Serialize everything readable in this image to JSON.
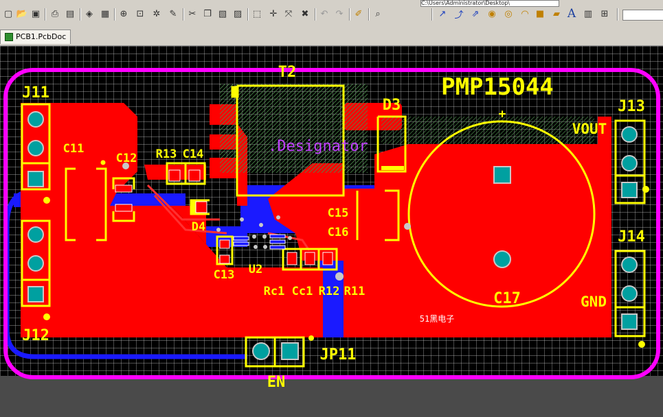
{
  "window": {
    "path": "C:\\Users\\Administrator\\Desktop\\"
  },
  "tab": {
    "label": "PCB1.PcbDoc"
  },
  "board": {
    "title": "PMP15044",
    "label_vout": "VOUT",
    "label_gnd": "GND",
    "label_en": "EN",
    "watermark": "51黑电子",
    "designator_text": ".Designator",
    "plus": "+",
    "components": {
      "T2": "T2",
      "D3": "D3",
      "J11": "J11",
      "J12": "J12",
      "J13": "J13",
      "J14": "J14",
      "C11": "C11",
      "C12": "C12",
      "R13": "R13",
      "C14": "C14",
      "D4": "D4",
      "C13": "C13",
      "U2": "U2",
      "Rc1": "Rc1",
      "Cc1": "Cc1",
      "R12": "R12",
      "R11": "R11",
      "C15": "C15",
      "C16": "C16",
      "C17": "C17",
      "JP11": "JP11"
    },
    "colors": {
      "top_copper": "#ff0000",
      "bottom_copper": "#1a1aff",
      "silkscreen": "#ffff00",
      "outline": "#ff00ff",
      "pad": "#00a0a0",
      "grid": "#ffffff",
      "background": "#000000"
    }
  },
  "toolbar": {
    "icons": [
      "new-icon",
      "open-icon",
      "save-icon",
      "print-icon",
      "print-preview-icon",
      "layers-icon",
      "board-icon",
      "zoom-icon",
      "zoom-area-icon",
      "zoom-fit-icon",
      "zoom-select-icon",
      "cut-icon",
      "copy-icon",
      "paste-icon",
      "rubber-stamp-icon",
      "select-icon",
      "move-icon",
      "cross-icon",
      "deselect-icon",
      "undo-icon",
      "redo-icon",
      "highlight-icon",
      "inspect-icon",
      "route-icon",
      "interactive-route-icon",
      "differential-icon",
      "via-icon",
      "arc-icon",
      "fill-icon",
      "text-icon",
      "component-icon",
      "grid-icon"
    ],
    "text_tool": "A"
  }
}
